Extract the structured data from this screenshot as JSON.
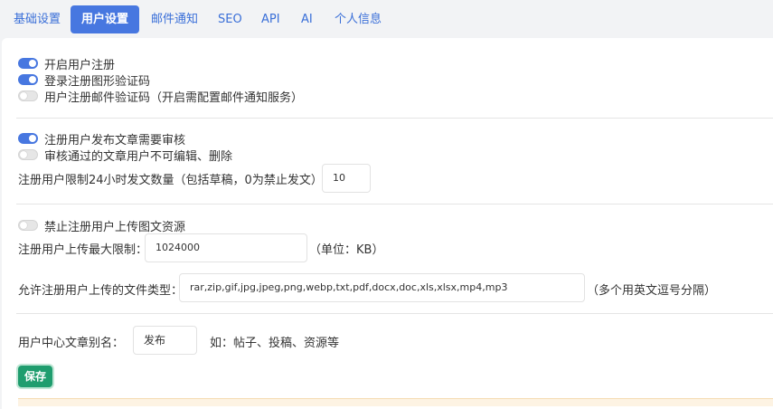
{
  "tabs": [
    "基础设置",
    "用户设置",
    "邮件通知",
    "SEO",
    "API",
    "AI",
    "个人信息"
  ],
  "active_tab": "用户设置",
  "toggles": {
    "enable_register": {
      "label": "开启用户注册",
      "on": true
    },
    "login_captcha": {
      "label": "登录注册图形验证码",
      "on": true
    },
    "register_email_code": {
      "label": "用户注册邮件验证码（开启需配置邮件通知服务）",
      "on": false
    },
    "post_review": {
      "label": "注册用户发布文章需要审核",
      "on": true
    },
    "no_edit_after_review": {
      "label": "审核通过的文章用户不可编辑、删除",
      "on": false
    },
    "forbid_upload": {
      "label": "禁止注册用户上传图文资源",
      "on": false
    }
  },
  "post_limit": {
    "label": "注册用户限制24小时发文数量（包括草稿，0为禁止发文）",
    "value": "10"
  },
  "upload_max": {
    "label": "注册用户上传最大限制：",
    "value": "1024000",
    "unit": "（单位：KB）"
  },
  "file_types": {
    "label": "允许注册用户上传的文件类型：",
    "value": "rar,zip,gif,jpg,jpeg,png,webp,txt,pdf,docx,doc,xls,xlsx,mp4,mp3",
    "hint": "（多个用英文逗号分隔）"
  },
  "article_alias": {
    "label": "用户中心文章别名：",
    "value": "发布",
    "hint": "如：帖子、投稿、资源等"
  },
  "save_label": "保存",
  "colors": {
    "accent": "#4777e0",
    "save": "#1f9d6e"
  }
}
